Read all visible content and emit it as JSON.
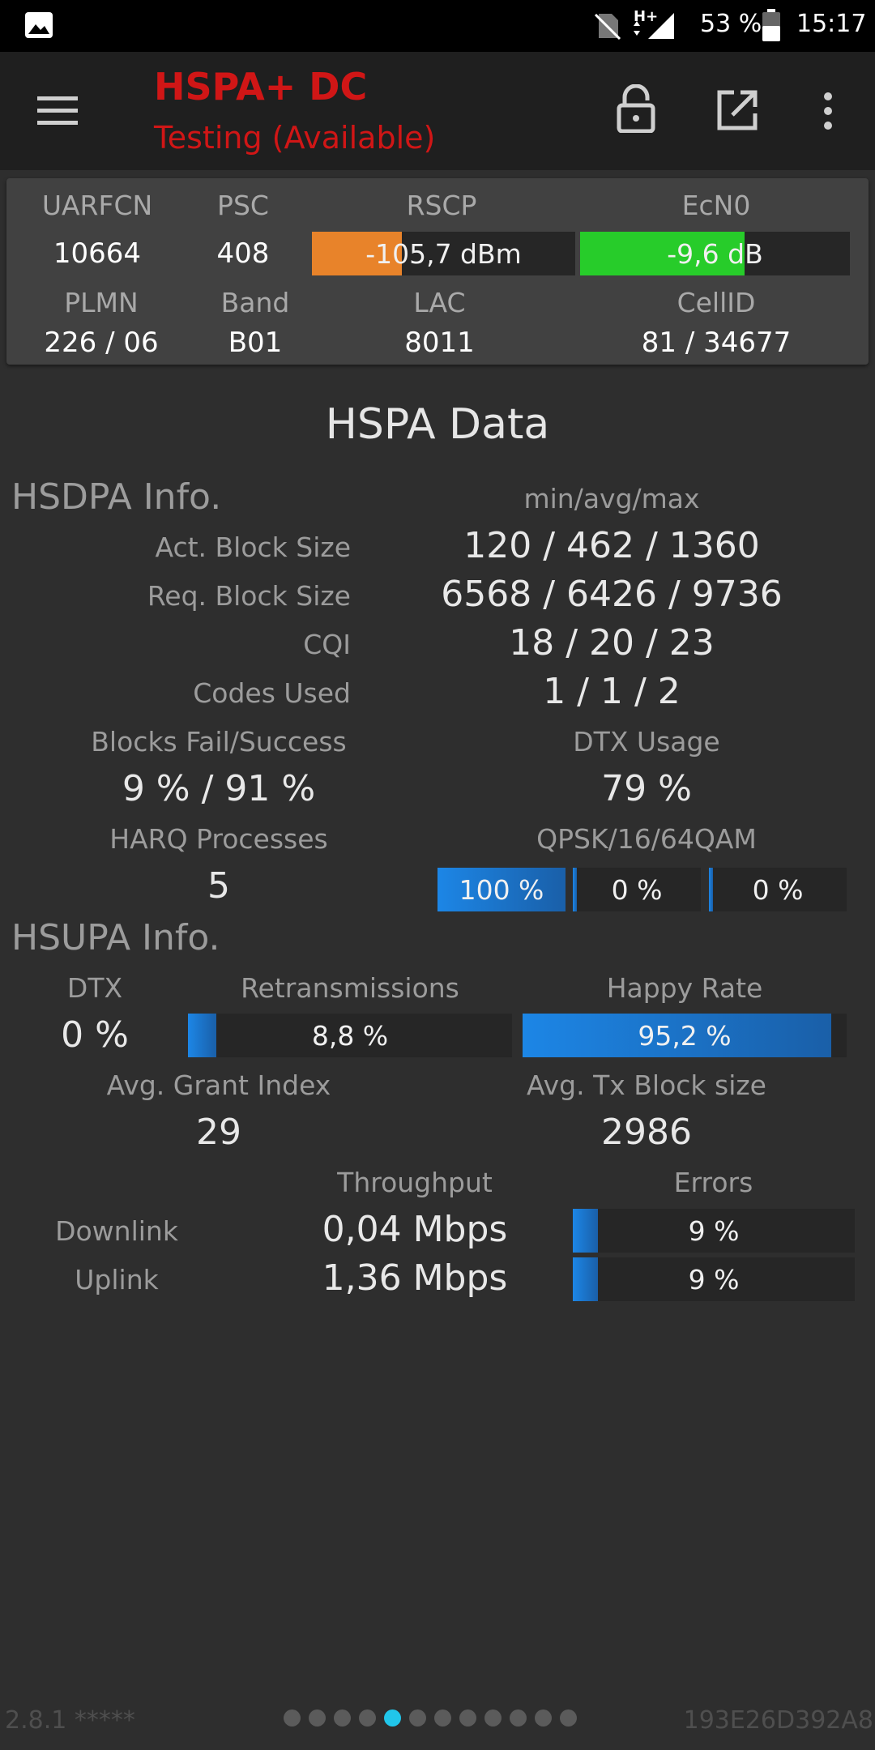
{
  "status_bar": {
    "signal_type": "H+",
    "battery": "53 %",
    "time": "15:17"
  },
  "app_bar": {
    "title": "HSPA+ DC",
    "subtitle": "Testing (Available)"
  },
  "cell_info": {
    "labels": {
      "uarfcn": "UARFCN",
      "psc": "PSC",
      "rscp": "RSCP",
      "ecn0": "EcN0",
      "plmn": "PLMN",
      "band": "Band",
      "lac": "LAC",
      "cellid": "CellID"
    },
    "uarfcn": "10664",
    "psc": "408",
    "rscp": {
      "text": "-105,7 dBm",
      "level": 0.34,
      "color": "#e8832a"
    },
    "ecn0": {
      "text": "-9,6 dB",
      "level": 0.61,
      "color": "#27cc2a"
    },
    "plmn": "226 / 06",
    "band": "B01",
    "lac": "8011",
    "cellid": "81 / 34677"
  },
  "page_title": "HSPA Data",
  "hsdpa": {
    "title": "HSDPA Info.",
    "minavgmax_label": "min/avg/max",
    "rows": [
      {
        "label": "Act. Block Size",
        "value": "120 / 462 / 1360"
      },
      {
        "label": "Req. Block Size",
        "value": "6568 / 6426 / 9736"
      },
      {
        "label": "CQI",
        "value": "18 / 20 / 23"
      },
      {
        "label": "Codes Used",
        "value": "1 / 1 / 2"
      }
    ],
    "blocks_label": "Blocks Fail/Success",
    "blocks_value": "9 % / 91 %",
    "dtx_label": "DTX Usage",
    "dtx_value": "79 %",
    "harq_label": "HARQ Processes",
    "harq_value": "5",
    "qam_label": "QPSK/16/64QAM",
    "qam": [
      {
        "text": "100 %",
        "level": 1.0
      },
      {
        "text": "0 %",
        "level": 0.0
      },
      {
        "text": "0 %",
        "level": 0.0
      }
    ]
  },
  "hsupa": {
    "title": "HSUPA Info.",
    "dtx_label": "DTX",
    "dtx_value": "0 %",
    "retrans_label": "Retransmissions",
    "retrans": {
      "text": "8,8 %",
      "level": 0.088
    },
    "happy_label": "Happy Rate",
    "happy": {
      "text": "95,2 %",
      "level": 0.952
    },
    "grant_label": "Avg. Grant Index",
    "grant_value": "29",
    "txblock_label": "Avg. Tx Block size",
    "txblock_value": "2986"
  },
  "throughput": {
    "throughput_label": "Throughput",
    "errors_label": "Errors",
    "downlink_label": "Downlink",
    "downlink_value": "0,04 Mbps",
    "downlink_errors": {
      "text": "9 %",
      "level": 0.09
    },
    "uplink_label": "Uplink",
    "uplink_value": "1,36 Mbps",
    "uplink_errors": {
      "text": "9 %",
      "level": 0.09
    }
  },
  "footer": {
    "version": "2.8.1 *****",
    "device_id": "193E26D392A8",
    "page_count": 12,
    "active_page": 5
  },
  "colors": {
    "accent_red": "#d01616",
    "bar_blue": "#1f7fd6",
    "dot_active": "#21c6ea"
  }
}
